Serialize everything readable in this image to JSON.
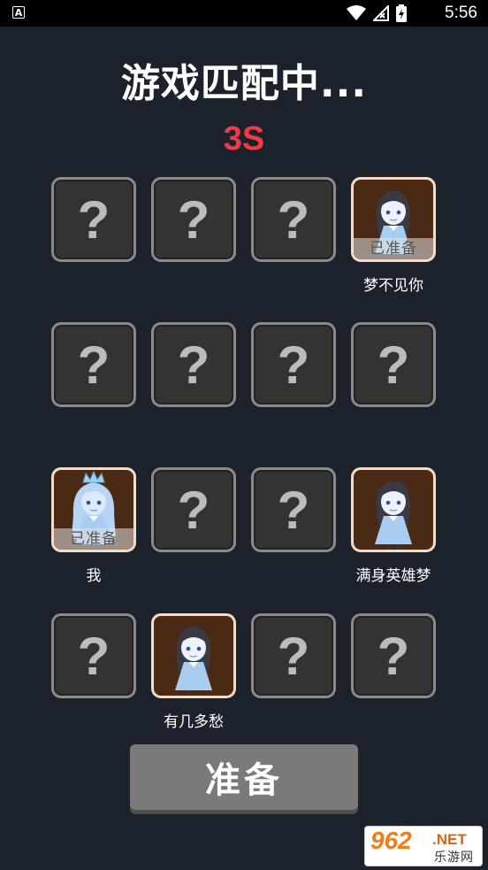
{
  "status_bar": {
    "time": "5:56",
    "app_icon_letter": "A"
  },
  "title": "游戏匹配中...",
  "countdown": "3S",
  "slots": [
    {
      "state": "empty",
      "q": "?"
    },
    {
      "state": "empty",
      "q": "?"
    },
    {
      "state": "empty",
      "q": "?"
    },
    {
      "state": "player",
      "avatar": "dark-hair-girl",
      "ready": "已准备",
      "name": "梦不见你"
    },
    {
      "state": "empty",
      "q": "?"
    },
    {
      "state": "empty",
      "q": "?"
    },
    {
      "state": "empty",
      "q": "?"
    },
    {
      "state": "empty",
      "q": "?"
    },
    {
      "state": "player",
      "avatar": "crowned-blue-hair-girl",
      "ready": "已准备",
      "name": "我"
    },
    {
      "state": "empty",
      "q": "?"
    },
    {
      "state": "empty",
      "q": "?"
    },
    {
      "state": "player",
      "avatar": "dark-hair-girl",
      "ready": "",
      "name": "满身英雄梦"
    },
    {
      "state": "empty",
      "q": "?"
    },
    {
      "state": "player",
      "avatar": "dark-hair-girl",
      "ready": "",
      "name": "有几多愁"
    },
    {
      "state": "empty",
      "q": "?"
    },
    {
      "state": "empty",
      "q": "?"
    }
  ],
  "ready_button": "准备",
  "watermark": {
    "number": "962",
    "suffix": ".NET",
    "sub": "乐游网"
  }
}
